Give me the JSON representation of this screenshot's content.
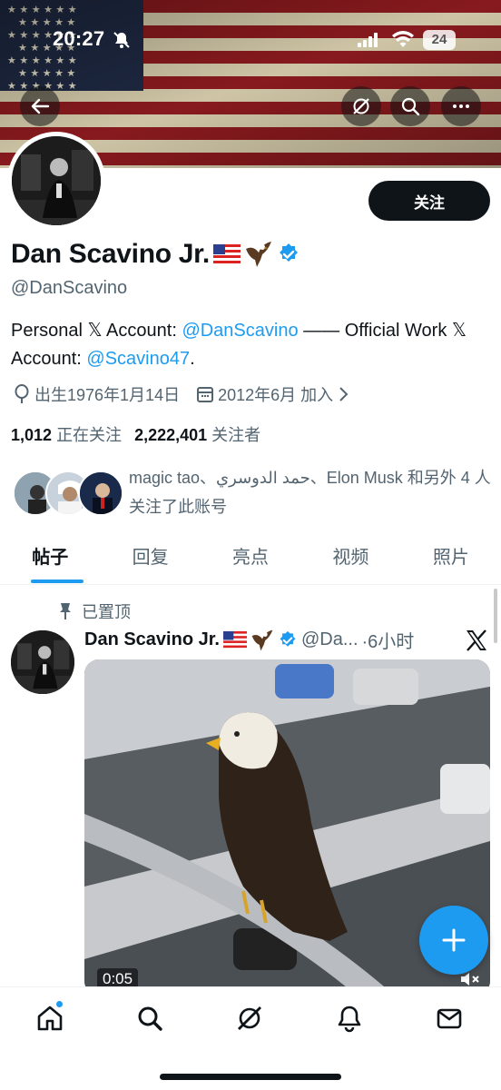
{
  "status_bar": {
    "time": "20:27",
    "battery": "24"
  },
  "banner": {
    "description_icon": "us-flag-banner"
  },
  "header_actions": {
    "back": "back-arrow-icon",
    "grok": "grok-icon",
    "search": "search-icon",
    "more": "more-dots-icon"
  },
  "profile": {
    "follow_label": "关注",
    "display_name": "Dan Scavino Jr.",
    "name_emojis": [
      "us-flag-emoji",
      "eagle-emoji"
    ],
    "verified": true,
    "handle": "@DanScavino",
    "bio": {
      "part1": "Personal 𝕏 Account: ",
      "link1": "@DanScavino",
      "part2": " —— Official Work 𝕏 Account: ",
      "link2": "@Scavino47",
      "part3": "."
    },
    "birth": "出生1976年1月14日",
    "joined": "2012年6月 加入",
    "following_count": "1,012",
    "following_label": "正在关注",
    "followers_count": "2,222,401",
    "followers_label": "关注者",
    "known_followers_text": "magic tao、حمد الدوسري、Elon Musk 和另外 4 人关注了此账号"
  },
  "tabs": [
    "帖子",
    "回复",
    "亮点",
    "视频",
    "照片"
  ],
  "active_tab": 0,
  "post": {
    "pinned_label": "已置顶",
    "author_name": "Dan Scavino Jr.",
    "author_handle": "@Da...",
    "time": "·6小时",
    "video_duration": "0:05"
  },
  "colors": {
    "accent": "#1d9bf0",
    "text": "#0f1419",
    "secondary": "#536471"
  },
  "bottom_nav": [
    "home-icon",
    "search-icon",
    "grok-icon",
    "notifications-icon",
    "messages-icon"
  ]
}
